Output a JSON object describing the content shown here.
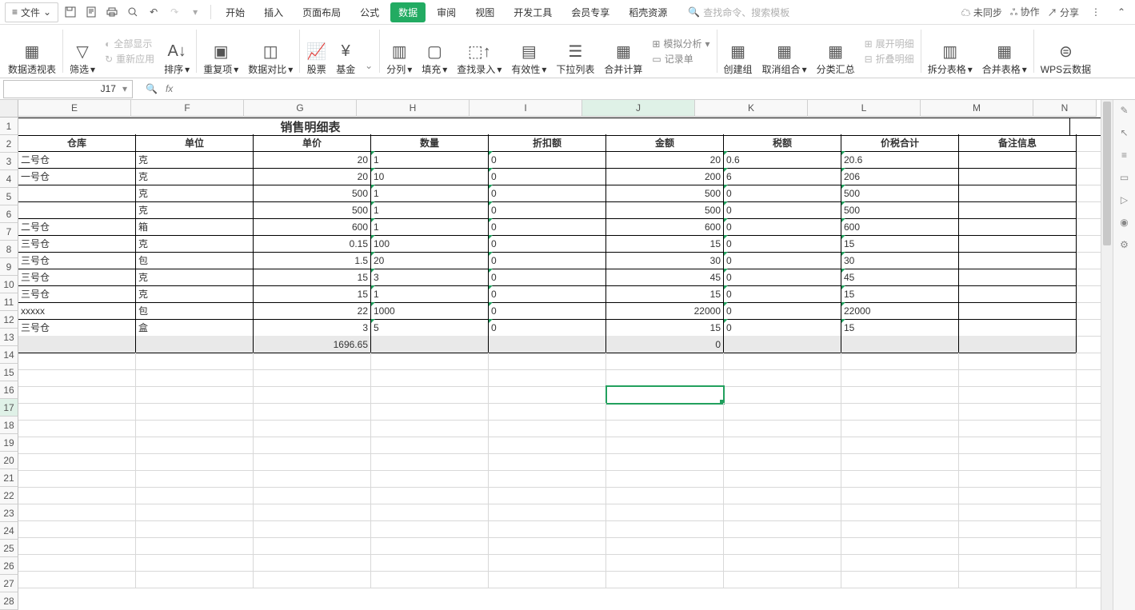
{
  "top": {
    "file": "文件",
    "tabs": [
      "开始",
      "插入",
      "页面布局",
      "公式",
      "数据",
      "审阅",
      "视图",
      "开发工具",
      "会员专享",
      "稻壳资源"
    ],
    "active_tab_index": 4,
    "search_placeholder": "查找命令、搜索模板",
    "sync": "未同步",
    "coop": "协作",
    "share": "分享"
  },
  "ribbon": {
    "pivot": "数据透视表",
    "filter": "筛选",
    "show_all": "全部显示",
    "reapply": "重新应用",
    "sort": "排序",
    "dup": "重复项",
    "compare": "数据对比",
    "stock": "股票",
    "fund": "基金",
    "splitcol": "分列",
    "fill": "填充",
    "lookup": "查找录入",
    "validity": "有效性",
    "dropdown": "下拉列表",
    "consolidate": "合并计算",
    "sim": "模拟分析",
    "record": "记录单",
    "group": "创建组",
    "ungroup": "取消组合",
    "subtotal": "分类汇总",
    "expand": "展开明细",
    "collapse": "折叠明细",
    "splittbl": "拆分表格",
    "mergetbl": "合并表格",
    "wps": "WPS云数据"
  },
  "fx": {
    "cell_ref": "J17"
  },
  "grid": {
    "cols": [
      "E",
      "F",
      "G",
      "H",
      "I",
      "J",
      "K",
      "L",
      "M",
      "N"
    ],
    "title": "销售明细表",
    "headers": [
      "仓库",
      "单位",
      "单价",
      "数量",
      "折扣额",
      "金额",
      "税额",
      "价税合计",
      "备注信息"
    ],
    "rows": [
      {
        "wh": "二号仓",
        "unit": "克",
        "price": "20",
        "qty": "1",
        "disc": "0",
        "amt": "20",
        "tax": "0.6",
        "tot": "20.6"
      },
      {
        "wh": "一号仓",
        "unit": "克",
        "price": "20",
        "qty": "10",
        "disc": "0",
        "amt": "200",
        "tax": "6",
        "tot": "206"
      },
      {
        "wh": "",
        "unit": "克",
        "price": "500",
        "qty": "1",
        "disc": "0",
        "amt": "500",
        "tax": "0",
        "tot": "500"
      },
      {
        "wh": "",
        "unit": "克",
        "price": "500",
        "qty": "1",
        "disc": "0",
        "amt": "500",
        "tax": "0",
        "tot": "500"
      },
      {
        "wh": "二号仓",
        "unit": "箱",
        "price": "600",
        "qty": "1",
        "disc": "0",
        "amt": "600",
        "tax": "0",
        "tot": "600"
      },
      {
        "wh": "三号仓",
        "unit": "克",
        "price": "0.15",
        "qty": "100",
        "disc": "0",
        "amt": "15",
        "tax": "0",
        "tot": "15"
      },
      {
        "wh": "三号仓",
        "unit": "包",
        "price": "1.5",
        "qty": "20",
        "disc": "0",
        "amt": "30",
        "tax": "0",
        "tot": "30"
      },
      {
        "wh": "三号仓",
        "unit": "克",
        "price": "15",
        "qty": "3",
        "disc": "0",
        "amt": "45",
        "tax": "0",
        "tot": "45"
      },
      {
        "wh": "三号仓",
        "unit": "克",
        "price": "15",
        "qty": "1",
        "disc": "0",
        "amt": "15",
        "tax": "0",
        "tot": "15"
      },
      {
        "wh": "xxxxx",
        "unit": "包",
        "price": "22",
        "qty": "1000",
        "disc": "0",
        "amt": "22000",
        "tax": "0",
        "tot": "22000"
      },
      {
        "wh": "三号仓",
        "unit": "盒",
        "price": "3",
        "qty": "5",
        "disc": "0",
        "amt": "15",
        "tax": "0",
        "tot": "15"
      }
    ],
    "totals": {
      "price": "1696.65",
      "amt": "0"
    },
    "selected": "J17",
    "row_count": 28
  }
}
